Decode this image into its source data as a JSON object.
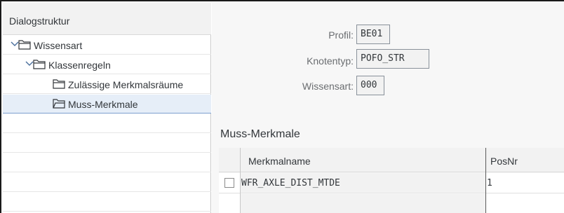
{
  "tree": {
    "header": "Dialogstruktur",
    "items": [
      {
        "label": "Wissensart",
        "expanded": true,
        "icon": "folder-open-icon"
      },
      {
        "label": "Klassenregeln",
        "expanded": true,
        "icon": "folder-open-icon"
      },
      {
        "label": "Zulässige Merkmalsräume",
        "icon": "folder-icon"
      },
      {
        "label": "Muss-Merkmale",
        "icon": "folder-open-icon",
        "selected": true
      }
    ]
  },
  "form": {
    "profil_label": "Profil:",
    "profil_value": "BE01",
    "knotentyp_label": "Knotentyp:",
    "knotentyp_value": "POFO_STR",
    "wissensart_label": "Wissensart:",
    "wissensart_value": "000"
  },
  "section": {
    "title": "Muss-Merkmale"
  },
  "table": {
    "columns": [
      "Merkmalname",
      "PosNr"
    ],
    "rows": [
      {
        "merkmalname": "WFR_AXLE_DIST_MTDE",
        "posnr": "1"
      }
    ]
  },
  "colors": {
    "selection": "#e6eef8",
    "selection_border": "#7da0cf",
    "panel_bg": "#f7f7f7",
    "header_bg": "#f2f2f2"
  }
}
